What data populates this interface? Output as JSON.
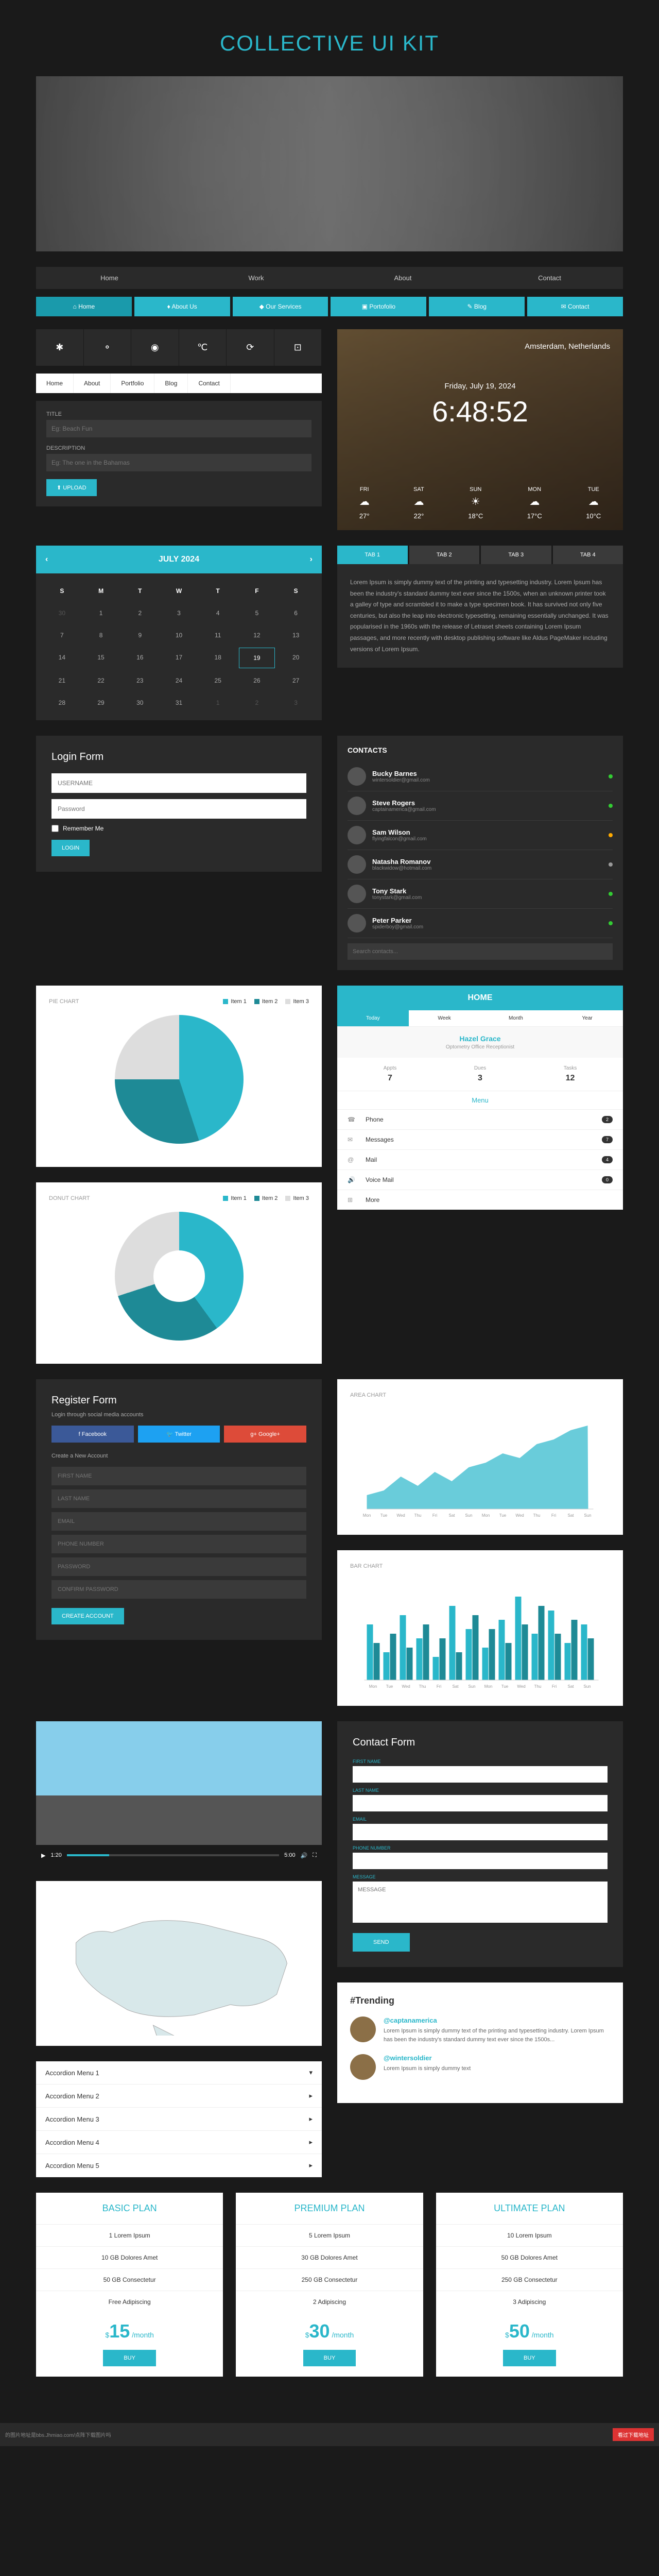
{
  "title": "COLLECTIVE UI KIT",
  "nav1": [
    "Home",
    "Work",
    "About",
    "Contact"
  ],
  "nav2": [
    {
      "icon": "⌂",
      "label": "Home"
    },
    {
      "icon": "♦",
      "label": "About Us"
    },
    {
      "icon": "◆",
      "label": "Our Services"
    },
    {
      "icon": "▣",
      "label": "Portofolio"
    },
    {
      "icon": "✎",
      "label": "Blog"
    },
    {
      "icon": "✉",
      "label": "Contact"
    }
  ],
  "iconRow": [
    "✱",
    "⚬",
    "◉",
    "℃",
    "⟳",
    "⊡"
  ],
  "nav3": [
    "Home",
    "About",
    "Portfolio",
    "Blog",
    "Contact"
  ],
  "form1": {
    "titleLbl": "TITLE",
    "titlePlaceholder": "Eg: Beach Fun",
    "descLbl": "DESCRIPTION",
    "descPlaceholder": "Eg: The one in the Bahamas",
    "uploadBtn": "⬆ UPLOAD"
  },
  "weather": {
    "location": "Amsterdam, Netherlands",
    "date": "Friday, July 19, 2024",
    "time": "6:48:52",
    "days": [
      {
        "d": "FRI",
        "i": "☁",
        "t": "27°"
      },
      {
        "d": "SAT",
        "i": "☁",
        "t": "22°"
      },
      {
        "d": "SUN",
        "i": "☀",
        "t": "18°C"
      },
      {
        "d": "MON",
        "i": "☁",
        "t": "17°C"
      },
      {
        "d": "TUE",
        "i": "☁",
        "t": "10°C"
      }
    ]
  },
  "calendar": {
    "month": "JULY 2024",
    "headers": [
      "S",
      "M",
      "T",
      "W",
      "T",
      "F",
      "S"
    ],
    "prevDays": [
      30,
      1,
      2,
      3,
      4,
      5,
      6
    ],
    "weeks": [
      [
        7,
        8,
        9,
        10,
        11,
        12,
        13
      ],
      [
        14,
        15,
        16,
        17,
        18,
        19,
        20
      ],
      [
        21,
        22,
        23,
        24,
        25,
        26,
        27
      ],
      [
        28,
        29,
        30,
        31,
        1,
        2,
        3
      ]
    ],
    "today": 19
  },
  "tabs": [
    "TAB 1",
    "TAB 2",
    "TAB 3",
    "TAB 4"
  ],
  "tabContent": "Lorem Ipsum is simply dummy text of the printing and typesetting industry. Lorem Ipsum has been the industry's standard dummy text ever since the 1500s, when an unknown printer took a galley of type and scrambled it to make a type specimen book. It has survived not only five centuries, but also the leap into electronic typesetting, remaining essentially unchanged. It was popularised in the 1960s with the release of Letraset sheets containing Lorem Ipsum passages, and more recently with desktop publishing software like Aldus PageMaker including versions of Lorem Ipsum.",
  "login": {
    "title": "Login Form",
    "userPh": "USERNAME",
    "passPh": "Password",
    "remember": "Remember Me",
    "btn": "LOGIN"
  },
  "contacts": {
    "title": "CONTACTS",
    "list": [
      {
        "name": "Bucky Barnes",
        "email": "wintersoldier@gmail.com",
        "status": "#3c3"
      },
      {
        "name": "Steve Rogers",
        "email": "captainamerica@gmail.com",
        "status": "#3c3"
      },
      {
        "name": "Sam Wilson",
        "email": "flyingfalcon@gmail.com",
        "status": "#fa0"
      },
      {
        "name": "Natasha Romanov",
        "email": "blackwidow@hotmail.com",
        "status": "#999"
      },
      {
        "name": "Tony Stark",
        "email": "tonystark@gmail.com",
        "status": "#3c3"
      },
      {
        "name": "Peter Parker",
        "email": "spiderboy@gmail.com",
        "status": "#3c3"
      }
    ],
    "searchPh": "Search contacts..."
  },
  "pieChart": {
    "title": "PIE CHART",
    "legend": [
      "Item 1",
      "Item 2",
      "Item 3"
    ]
  },
  "donutChart": {
    "title": "DONUT CHART",
    "legend": [
      "Item 1",
      "Item 2",
      "Item 3"
    ]
  },
  "home": {
    "title": "HOME",
    "tabs": [
      "Today",
      "Week",
      "Month",
      "Year"
    ],
    "userName": "Hazel Grace",
    "userRole": "Optometry Office Receptionist",
    "stats": [
      {
        "lbl": "Appts",
        "val": "7"
      },
      {
        "lbl": "Dues",
        "val": "3"
      },
      {
        "lbl": "Tasks",
        "val": "12"
      }
    ],
    "menuTitle": "Menu",
    "menu": [
      {
        "icon": "☎",
        "label": "Phone",
        "badge": "2"
      },
      {
        "icon": "✉",
        "label": "Messages",
        "badge": "7"
      },
      {
        "icon": "@",
        "label": "Mail",
        "badge": "4"
      },
      {
        "icon": "🔊",
        "label": "Voice Mail",
        "badge": "0"
      },
      {
        "icon": "⊞",
        "label": "More",
        "badge": ""
      }
    ]
  },
  "register": {
    "title": "Register Form",
    "sub": "Login through social media accounts",
    "fb": "Facebook",
    "tw": "Twitter",
    "gg": "Google+",
    "createTitle": "Create a New Account",
    "fields": [
      "FIRST NAME",
      "LAST NAME",
      "EMAIL",
      "PHONE NUMBER",
      "PASSWORD",
      "CONFIRM PASSWORD"
    ],
    "btn": "CREATE ACCOUNT"
  },
  "areaChart": {
    "title": "AREA CHART",
    "xlabels": [
      "Mon",
      "Tue",
      "Wed",
      "Thu",
      "Fri",
      "Sat",
      "Sun",
      "Mon",
      "Tue",
      "Wed",
      "Thu",
      "Fri",
      "Sat",
      "Sun"
    ]
  },
  "barChart": {
    "title": "BAR CHART",
    "xlabels": [
      "Mon",
      "Tue",
      "Wed",
      "Thu",
      "Fri",
      "Sat",
      "Sun",
      "Mon",
      "Tue",
      "Wed",
      "Thu",
      "Fri",
      "Sat",
      "Sun"
    ]
  },
  "video": {
    "time1": "1:20",
    "time2": "5:00"
  },
  "accordion": [
    "Accordion Menu 1",
    "Accordion Menu 2",
    "Accordion Menu 3",
    "Accordion Menu 4",
    "Accordion Menu 5"
  ],
  "contactForm": {
    "title": "Contact Form",
    "labels": [
      "FIRST NAME",
      "LAST NAME",
      "EMAIL",
      "PHONE NUMBER",
      "MESSAGE"
    ],
    "msgPh": "MESSAGE",
    "btn": "SEND"
  },
  "trending": {
    "title": "#Trending",
    "tweets": [
      {
        "handle": "@captanamerica",
        "txt": "Lorem Ipsum is simply dummy text of the printing and typesetting industry. Lorem Ipsum has been the industry's standard dummy text ever since the 1500s..."
      },
      {
        "handle": "@wintersoldier",
        "txt": "Lorem Ipsum is simply dummy text"
      }
    ]
  },
  "pricing": [
    {
      "name": "BASIC PLAN",
      "feats": [
        "1 Lorem Ipsum",
        "10 GB Dolores Amet",
        "50 GB Consectetur",
        "Free Adipiscing"
      ],
      "price": "15"
    },
    {
      "name": "PREMIUM PLAN",
      "feats": [
        "5 Lorem Ipsum",
        "30 GB Dolores Amet",
        "250 GB Consectetur",
        "2 Adipiscing"
      ],
      "price": "30"
    },
    {
      "name": "ULTIMATE PLAN",
      "feats": [
        "10 Lorem Ipsum",
        "50 GB Dolores Amet",
        "250 GB Consectetur",
        "3 Adipiscing"
      ],
      "price": "50"
    }
  ],
  "buyBtn": "BUY",
  "footer": {
    "left": "的图片地址是bbs.Jhmiao.com/点阵下载图片吗",
    "right": "看过下载地址"
  },
  "chart_data": [
    {
      "type": "pie",
      "title": "PIE CHART",
      "series": [
        {
          "name": "Item 1",
          "value": 45
        },
        {
          "name": "Item 2",
          "value": 30
        },
        {
          "name": "Item 3",
          "value": 25
        }
      ]
    },
    {
      "type": "pie",
      "title": "DONUT CHART",
      "series": [
        {
          "name": "Item 1",
          "value": 40
        },
        {
          "name": "Item 2",
          "value": 30
        },
        {
          "name": "Item 3",
          "value": 30
        }
      ]
    },
    {
      "type": "area",
      "title": "AREA CHART",
      "categories": [
        "Mon",
        "Tue",
        "Wed",
        "Thu",
        "Fri",
        "Sat",
        "Sun",
        "Mon",
        "Tue",
        "Wed",
        "Thu",
        "Fri",
        "Sat",
        "Sun"
      ],
      "values": [
        15,
        20,
        35,
        25,
        40,
        30,
        45,
        50,
        60,
        55,
        70,
        75,
        85,
        90
      ],
      "ylim": [
        0,
        100
      ]
    },
    {
      "type": "bar",
      "title": "BAR CHART",
      "categories": [
        "Mon",
        "Tue",
        "Wed",
        "Thu",
        "Fri",
        "Sat",
        "Sun",
        "Mon",
        "Tue",
        "Wed",
        "Thu",
        "Fri",
        "Sat",
        "Sun"
      ],
      "series": [
        {
          "name": "A",
          "values": [
            60,
            30,
            70,
            45,
            25,
            80,
            55,
            35,
            65,
            90,
            50,
            75,
            40,
            60
          ]
        },
        {
          "name": "B",
          "values": [
            40,
            50,
            35,
            60,
            45,
            30,
            70,
            55,
            40,
            60,
            80,
            50,
            65,
            45
          ]
        }
      ],
      "ylim": [
        0,
        100
      ]
    }
  ]
}
